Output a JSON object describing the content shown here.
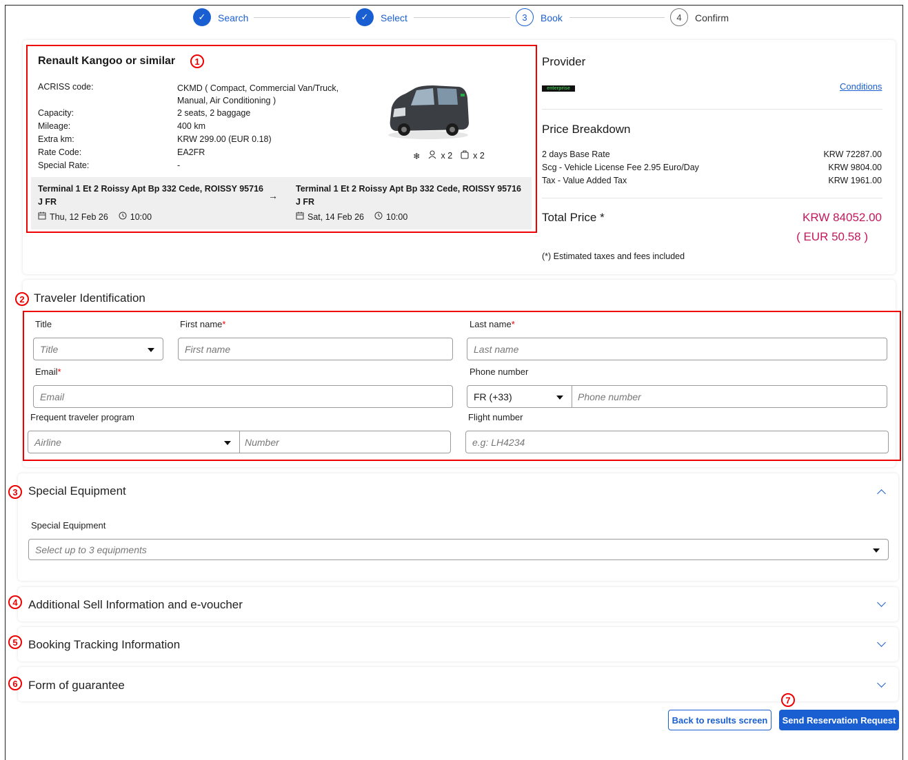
{
  "stepper": {
    "steps": [
      {
        "label": "Search",
        "state": "done"
      },
      {
        "label": "Select",
        "state": "done"
      },
      {
        "label": "Book",
        "number": "3",
        "state": "active"
      },
      {
        "label": "Confirm",
        "number": "4",
        "state": "pending"
      }
    ]
  },
  "car": {
    "title": "Renault Kangoo or similar",
    "details": [
      {
        "label": "ACRISS code:",
        "value": "CKMD ( Compact, Commercial Van/Truck, Manual, Air Conditioning )"
      },
      {
        "label": "Capacity:",
        "value": "2 seats, 2 baggage"
      },
      {
        "label": "Mileage:",
        "value": "400 km"
      },
      {
        "label": "Extra km:",
        "value": "KRW 299.00 (EUR 0.18)"
      },
      {
        "label": "Rate Code:",
        "value": "EA2FR"
      },
      {
        "label": "Special Rate:",
        "value": "-"
      }
    ],
    "features": {
      "ac_icon": "snowflake-icon",
      "seats": "x 2",
      "bags": "x 2"
    },
    "pickup": {
      "location": "Terminal 1 Et 2 Roissy Apt Bp 332 Cede, ROISSY 95716 J FR",
      "date": "Thu, 12 Feb 26",
      "time": "10:00"
    },
    "dropoff": {
      "location": "Terminal 1 Et 2 Roissy Apt Bp 332 Cede, ROISSY 95716 J FR",
      "date": "Sat, 14 Feb 26",
      "time": "10:00"
    },
    "arrow": "→"
  },
  "provider": {
    "title": "Provider",
    "logo_text": "enterprise",
    "conditions_link": "Conditions"
  },
  "price": {
    "title": "Price Breakdown",
    "rows": [
      {
        "label": "2 days Base Rate",
        "value": "KRW 72287.00"
      },
      {
        "label": "Scg - Vehicle License Fee 2.95 Euro/Day",
        "value": "KRW 9804.00"
      },
      {
        "label": "Tax - Value Added Tax",
        "value": "KRW 1961.00"
      }
    ],
    "total_label": "Total Price *",
    "total_value": "KRW 84052.00",
    "total_eur": "( EUR 50.58 )",
    "note": "(*) Estimated taxes and fees included",
    "accent": "#c2185b"
  },
  "traveler": {
    "title": "Traveler Identification",
    "title_label": "Title",
    "title_placeholder": "Title",
    "first_label": "First name",
    "first_placeholder": "First name",
    "last_label": "Last name",
    "last_placeholder": "Last name",
    "email_label": "Email",
    "email_placeholder": "Email",
    "phone_label": "Phone number",
    "phone_code": "FR (+33)",
    "phone_placeholder": "Phone number",
    "ftp_label": "Frequent traveler program",
    "airline_placeholder": "Airline",
    "number_placeholder": "Number",
    "flight_label": "Flight number",
    "flight_placeholder": "e.g: LH4234",
    "required_mark": "*"
  },
  "special_equipment": {
    "title": "Special Equipment",
    "field_label": "Special Equipment",
    "placeholder": "Select up to 3 equipments"
  },
  "sections": {
    "additional": "Additional Sell Information and e-voucher",
    "tracking": "Booking Tracking Information",
    "guarantee": "Form of guarantee"
  },
  "badges": [
    "1",
    "2",
    "3",
    "4",
    "5",
    "6",
    "7"
  ],
  "buttons": {
    "back": "Back to results screen",
    "send": "Send Reservation Request"
  },
  "colors": {
    "primary": "#1a5fd1",
    "annotation": "#e00000"
  }
}
